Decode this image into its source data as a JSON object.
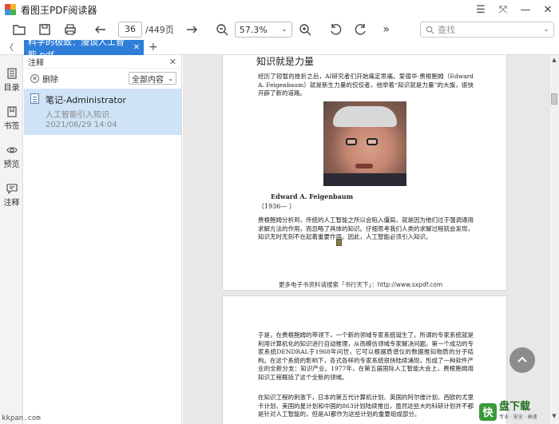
{
  "window": {
    "title": "看图王PDF阅读器",
    "controls": [
      "menu-icon",
      "fullscreen-icon",
      "minimize-icon",
      "close-icon"
    ]
  },
  "toolbar": {
    "page_current": "36",
    "page_total": "/449页",
    "zoom": "57.3%",
    "search_placeholder": "查找"
  },
  "tabs": [
    {
      "label": "科学的极致：漫谈人工智能.pdf",
      "active": true
    }
  ],
  "rail": [
    {
      "label": "目录",
      "icon": "toc-icon"
    },
    {
      "label": "书签",
      "icon": "bookmark-icon"
    },
    {
      "label": "预览",
      "icon": "preview-icon"
    },
    {
      "label": "注释",
      "icon": "annotation-icon"
    }
  ],
  "panel": {
    "title": "注释",
    "delete_label": "删除",
    "filter_value": "全部内容",
    "notes": [
      {
        "author": "笔记-Administrator",
        "text": "人工智能引入知识",
        "date": "2021/06/29 14:04"
      }
    ]
  },
  "page1": {
    "heading": "知识就是力量",
    "para1": "经历了短暂的挫折之后，AI研究者们开始痛定思痛。爱德华·费根鲍姆（Edward A. Feigenbaum）就是新生力量的佼佼者，他举着“知识就是力量”的大旗，很快开辟了新的道路。",
    "caption_name": "Edward A. Feigenbaum",
    "caption_year": "（1936—  ）",
    "para2": "费根鲍姆分析到，传统的人工智能之所以会陷入僵局，就是因为他们过于强调通用求解方法的作用，而忽略了具体的知识。仔细思考我们人类的求解过程就会发现，知识无时无刻不在起着重要作用。因此，人工智能必须引入知识。",
    "footer": "更多电子书资料请搜索「书行天下」：http://www.sxpdf.com"
  },
  "page2": {
    "para1": "于是，在费根鲍姆的带领下，一个新的领域专家系统诞生了。所谓的专家系统就是利用计算机化的知识进行自动推理，从而模仿领域专家解决问题。第一个成功的专家系统DENDRAL于1968年问世，它可以根据质谱仪的数据推知物质的分子结构。在这个系统的影响下，各式各样的专家系统很快陆续涌现，形成了一种软件产业的全新分支：知识产业。1977年，在第五届国际人工智能大会上，费根鲍姆用知识工程概括了这个全新的领域。",
    "para2": "在知识工程的刺激下，日本的第五代计算机计划、英国的阿尔维计划、西欧的尤里卡计划、美国的星计划和中国的863计划陆续推出，虽然这些大的科研计划并不都是针对人工智能的，但是AI都作为这些计划的重要组成部分。"
  },
  "watermarks": {
    "left": "kkpan.com",
    "right_logo": "快",
    "right_text": "盘下载",
    "right_sub": "专业 · 安全 · 高速"
  }
}
